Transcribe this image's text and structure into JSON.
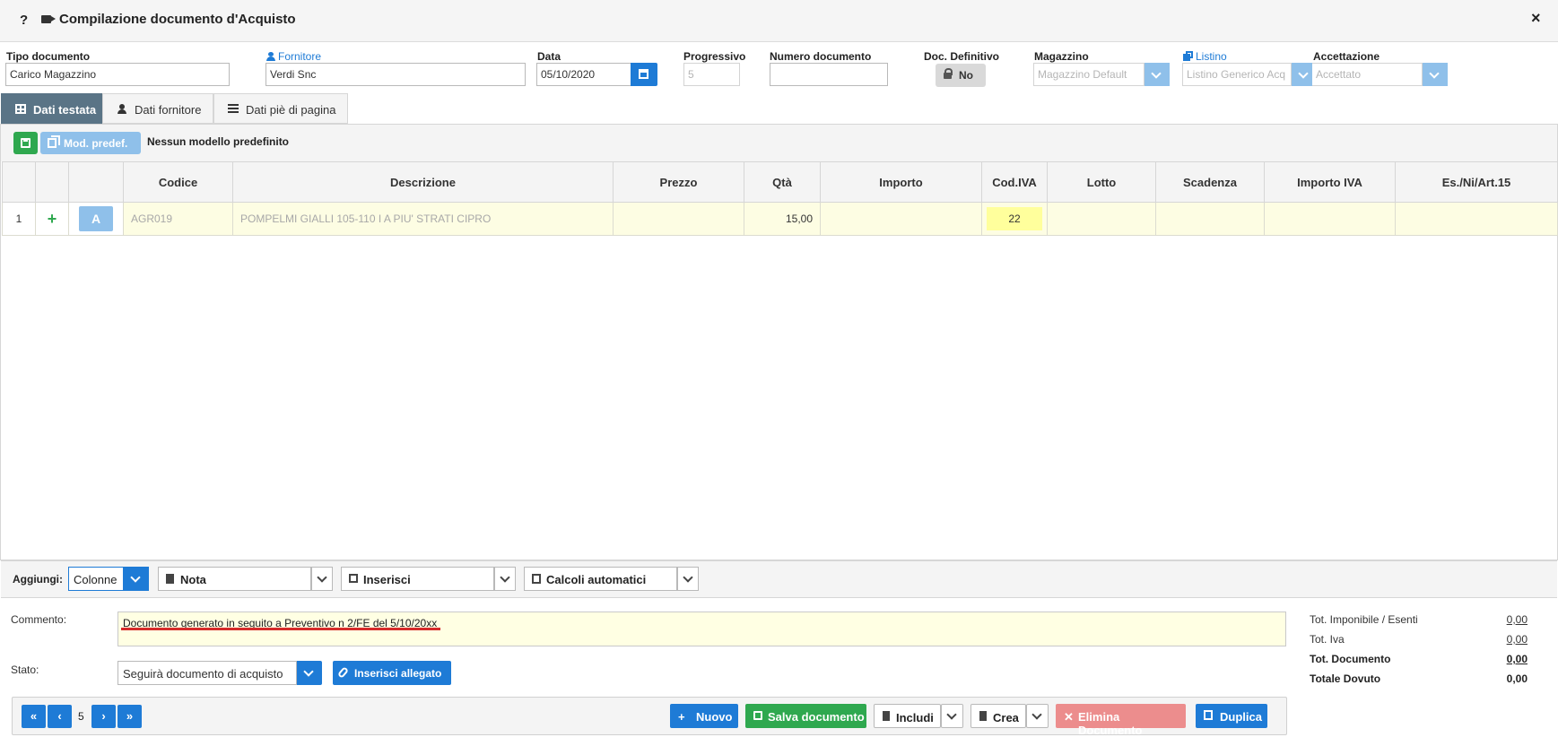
{
  "titlebar": {
    "help": "?",
    "title": "Compilazione documento d'Acquisto",
    "close": "×"
  },
  "fields": {
    "tipo_documento": {
      "label": "Tipo documento",
      "value": "Carico Magazzino"
    },
    "fornitore": {
      "label": "Fornitore",
      "value": "Verdi Snc"
    },
    "data": {
      "label": "Data",
      "value": "05/10/2020"
    },
    "progressivo": {
      "label": "Progressivo",
      "value": "5"
    },
    "numero_documento": {
      "label": "Numero documento",
      "value": ""
    },
    "doc_definitivo": {
      "label": "Doc. Definitivo",
      "value": "No"
    },
    "magazzino": {
      "label": "Magazzino",
      "value": "Magazzino Default"
    },
    "listino": {
      "label": "Listino",
      "value": "Listino Generico Acq"
    },
    "accettazione": {
      "label": "Accettazione",
      "value": "Accettato"
    }
  },
  "tabs": [
    {
      "label": "Dati testata",
      "icon": "grid-icon",
      "active": true
    },
    {
      "label": "Dati fornitore",
      "icon": "user-icon",
      "active": false
    },
    {
      "label": "Dati piè di pagina",
      "icon": "list-icon",
      "active": false
    }
  ],
  "toolbar": {
    "mod_label": "Mod. predef.",
    "model_text": "Nessun modello predefinito"
  },
  "table": {
    "headers": [
      "",
      "",
      "",
      "Codice",
      "Descrizione",
      "Prezzo",
      "Qtà",
      "Importo",
      "Cod.IVA",
      "Lotto",
      "Scadenza",
      "Importo IVA",
      "Es./Ni/Art.15"
    ],
    "rows": [
      {
        "num": "1",
        "plus": "+",
        "a": "A",
        "codice": "AGR019",
        "descrizione": "POMPELMI GIALLI 105-110 I A PIU' STRATI     CIPRO",
        "prezzo": "",
        "qta": "15,00",
        "importo": "",
        "cod_iva": "22",
        "lotto": "",
        "scadenza": "",
        "importo_iva": "",
        "esenzione": ""
      }
    ]
  },
  "aggiungi": {
    "label": "Aggiungi:",
    "colonne": "Colonne",
    "nota": "Nota",
    "inserisci": "Inserisci",
    "calcoli": "Calcoli automatici"
  },
  "commento": {
    "label": "Commento:",
    "value": "Documento generato in seguito a Preventivo n 2/FE del 5/10/20xx"
  },
  "stato": {
    "label": "Stato:",
    "value": "Seguirà documento di acquisto",
    "allegato": "Inserisci allegato"
  },
  "totals": {
    "imponibile_label": "Tot. Imponibile / Esenti",
    "imponibile": "0,00",
    "iva_label": "Tot. Iva",
    "iva": "0,00",
    "documento_label": "Tot. Documento",
    "documento": "0,00",
    "dovuto_label": "Totale Dovuto",
    "dovuto": "0,00"
  },
  "footer": {
    "first": "«",
    "prev": "‹",
    "page": "5",
    "next": "›",
    "last": "»",
    "nuovo": "Nuovo",
    "salva": "Salva documento",
    "includi": "Includi",
    "crea": "Crea",
    "elimina": "Elimina Documento",
    "duplica": "Duplica"
  },
  "colors": {
    "accent": "#1e7bd6",
    "success": "#2fa84f",
    "danger_disabled": "#ec8d8d",
    "active_tab": "#5a7486",
    "highlight": "#ffff9c"
  }
}
